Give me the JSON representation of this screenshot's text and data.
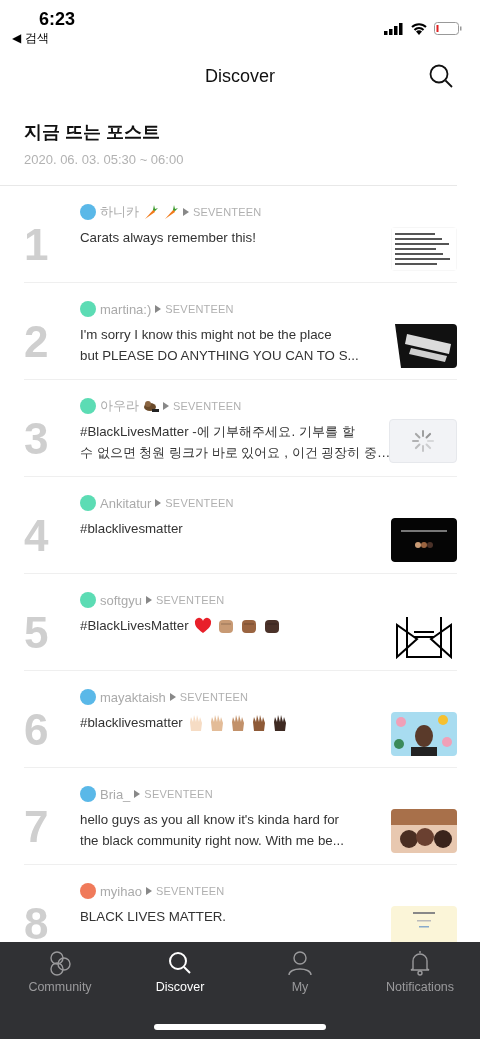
{
  "status_bar": {
    "time": "6:23",
    "back_label": "◀ 검색"
  },
  "header": {
    "title": "Discover"
  },
  "section": {
    "title": "지금 뜨는 포스트",
    "period": "2020. 06. 03. 05:30 ~ 06:00"
  },
  "posts": [
    {
      "rank": "1",
      "color": "#5ab8e8",
      "author": "하니카",
      "author_emoji": [
        {
          "kind": "carrot"
        },
        {
          "kind": "carrot"
        }
      ],
      "community": "SEVENTEEN",
      "lines": [
        "Carats always remember this!"
      ],
      "thumbnail": {
        "kind": "picture"
      }
    },
    {
      "rank": "2",
      "color": "#5cdcb4",
      "author": "martina:)",
      "community": "SEVENTEEN",
      "lines": [
        "I'm sorry I know this might not be the place",
        "but PLEASE DO ANYTHING YOU CAN TO S..."
      ],
      "thumbnail": {
        "kind": "picture"
      }
    },
    {
      "rank": "3",
      "color": "#5cdcb4",
      "author": "아우라",
      "author_emoji": [
        {
          "kind": "animal"
        }
      ],
      "community": "SEVENTEEN",
      "lines": [
        "#BlackLivesMatter  -에 기부해주세요. 기부를 할",
        "수 없으면 청원 링크가 바로 있어요 , 이건 굉장히 중…"
      ],
      "thumbnail": {
        "kind": "loading"
      }
    },
    {
      "rank": "4",
      "color": "#5cdcb4",
      "author": "Ankitatur",
      "community": "SEVENTEEN",
      "lines": [
        "#blacklivesmatter"
      ],
      "thumbnail": {
        "kind": "picture"
      }
    },
    {
      "rank": "5",
      "color": "#5cdcb4",
      "author": "softgyu",
      "community": "SEVENTEEN",
      "lines": [
        "#BlackLivesMatter"
      ],
      "text_emoji": [
        {
          "kind": "heart",
          "color": "#e8202a"
        },
        {
          "kind": "fist",
          "color": "#c89a74"
        },
        {
          "kind": "fist",
          "color": "#9a6440"
        },
        {
          "kind": "fist",
          "color": "#4a3128"
        }
      ],
      "thumbnail": {
        "kind": "picture"
      }
    },
    {
      "rank": "6",
      "color": "#5ab8e8",
      "author": "mayaktaish",
      "community": "SEVENTEEN",
      "lines": [
        "#blacklivesmatter"
      ],
      "text_emoji": [
        {
          "kind": "hand",
          "color": "#f6dcc4"
        },
        {
          "kind": "hand",
          "color": "#e3bc98"
        },
        {
          "kind": "hand",
          "color": "#c2916a"
        },
        {
          "kind": "hand",
          "color": "#8e5a37"
        },
        {
          "kind": "hand",
          "color": "#3e2a22"
        }
      ],
      "thumbnail": {
        "kind": "picture"
      }
    },
    {
      "rank": "7",
      "color": "#5ab8e8",
      "author": "Bria_",
      "community": "SEVENTEEN",
      "lines": [
        "hello guys as you all know it's kinda hard for",
        "the black community right now. With me be..."
      ],
      "thumbnail": {
        "kind": "picture"
      }
    },
    {
      "rank": "8",
      "color": "#f07a5a",
      "author": "myihao",
      "community": "SEVENTEEN",
      "lines": [
        "BLACK LIVES MATTER."
      ],
      "thumbnail": {
        "kind": "picture"
      }
    }
  ],
  "tab_bar": [
    {
      "label": "Community",
      "kind": "circles",
      "selected": false
    },
    {
      "label": "Discover",
      "kind": "search",
      "selected": true
    },
    {
      "label": "My",
      "kind": "person",
      "selected": false
    },
    {
      "label": "Notifications",
      "kind": "bell",
      "selected": false
    }
  ]
}
